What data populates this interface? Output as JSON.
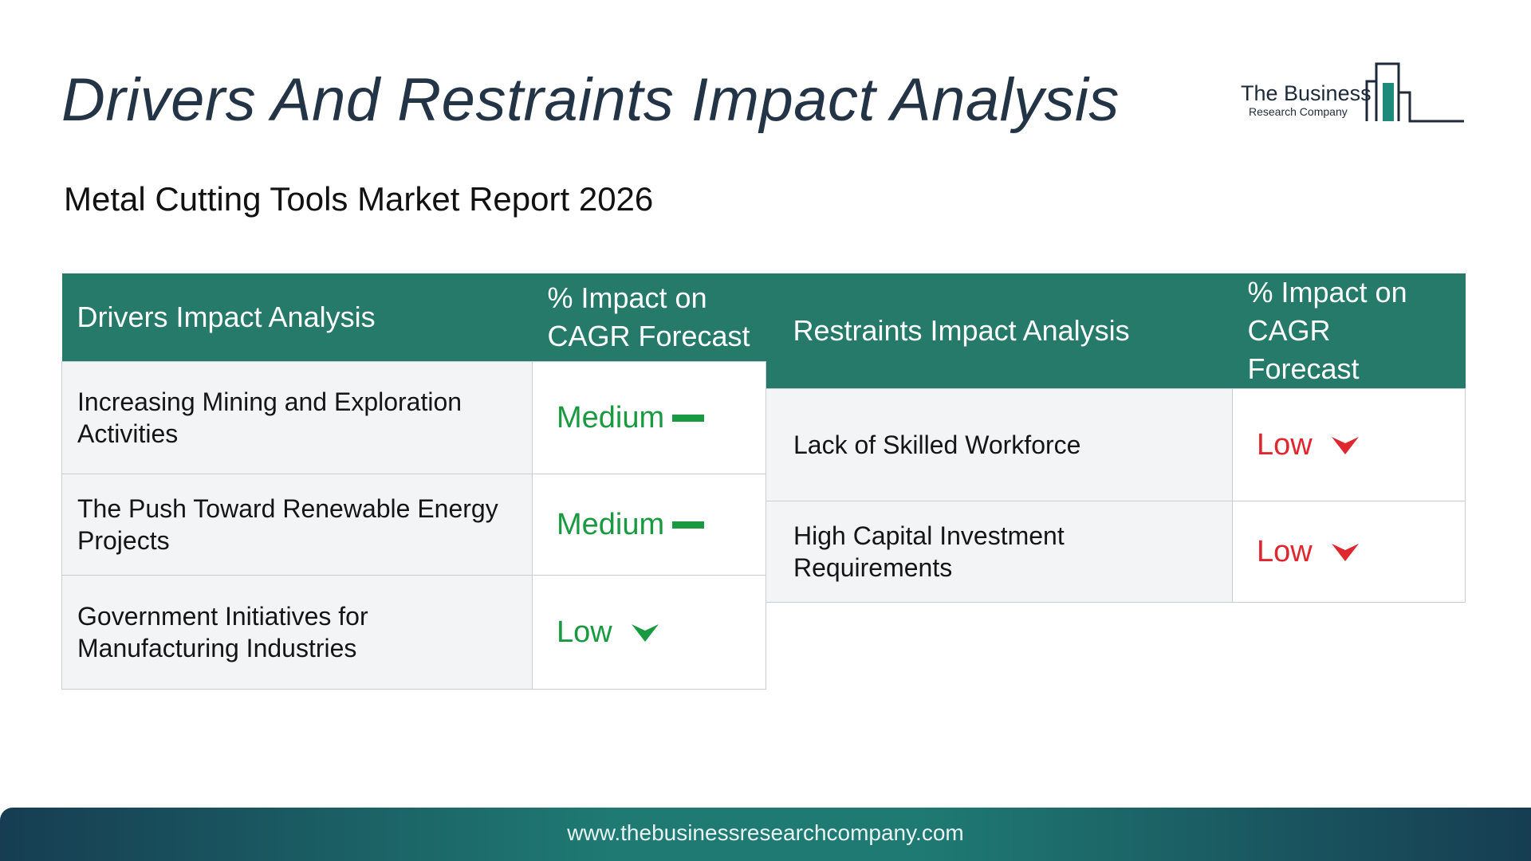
{
  "title": "Drivers And Restraints Impact Analysis",
  "subtitle": "Metal Cutting Tools Market Report 2026",
  "logo": {
    "line1": "The Business",
    "line2": "Research Company"
  },
  "drivers": {
    "header_label": "Drivers Impact Analysis",
    "header_impact": "% Impact on CAGR Forecast",
    "rows": [
      {
        "label": "Increasing Mining and Exploration Activities",
        "impact": "Medium",
        "indicator": "dash-icon"
      },
      {
        "label": "The Push Toward Renewable Energy Projects",
        "impact": "Medium",
        "indicator": "dash-icon"
      },
      {
        "label": "Government Initiatives for Manufacturing Industries",
        "impact": "Low",
        "indicator": "arrow-down-icon"
      }
    ]
  },
  "restraints": {
    "header_label": "Restraints Impact Analysis",
    "header_impact": "% Impact on CAGR Forecast",
    "rows": [
      {
        "label": "Lack of Skilled Workforce",
        "impact": "Low",
        "indicator": "arrow-down-icon"
      },
      {
        "label": "High Capital Investment Requirements",
        "impact": "Low",
        "indicator": "arrow-down-icon"
      }
    ]
  },
  "footer": {
    "url": "www.thebusinessresearchcompany.com"
  },
  "colors": {
    "header_bg": "#267a6a",
    "driver_impact": "#1a9a40",
    "restraint_impact": "#e0262e",
    "title": "#243447"
  }
}
